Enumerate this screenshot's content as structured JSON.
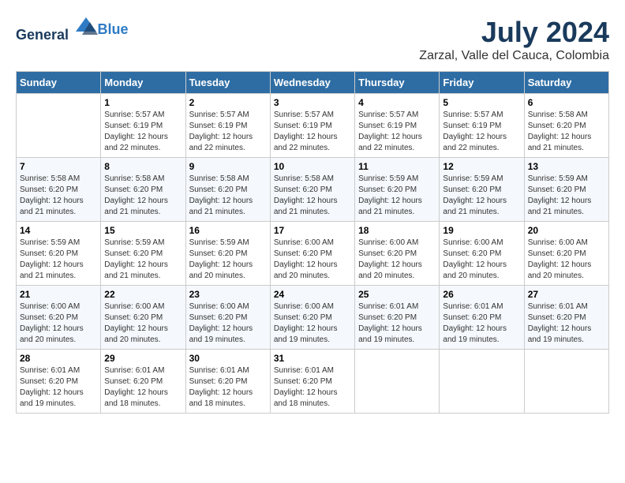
{
  "logo": {
    "general": "General",
    "blue": "Blue"
  },
  "title": "July 2024",
  "subtitle": "Zarzal, Valle del Cauca, Colombia",
  "days_of_week": [
    "Sunday",
    "Monday",
    "Tuesday",
    "Wednesday",
    "Thursday",
    "Friday",
    "Saturday"
  ],
  "weeks": [
    [
      {
        "day": "",
        "info": ""
      },
      {
        "day": "1",
        "info": "Sunrise: 5:57 AM\nSunset: 6:19 PM\nDaylight: 12 hours\nand 22 minutes."
      },
      {
        "day": "2",
        "info": "Sunrise: 5:57 AM\nSunset: 6:19 PM\nDaylight: 12 hours\nand 22 minutes."
      },
      {
        "day": "3",
        "info": "Sunrise: 5:57 AM\nSunset: 6:19 PM\nDaylight: 12 hours\nand 22 minutes."
      },
      {
        "day": "4",
        "info": "Sunrise: 5:57 AM\nSunset: 6:19 PM\nDaylight: 12 hours\nand 22 minutes."
      },
      {
        "day": "5",
        "info": "Sunrise: 5:57 AM\nSunset: 6:19 PM\nDaylight: 12 hours\nand 22 minutes."
      },
      {
        "day": "6",
        "info": "Sunrise: 5:58 AM\nSunset: 6:20 PM\nDaylight: 12 hours\nand 21 minutes."
      }
    ],
    [
      {
        "day": "7",
        "info": "Sunrise: 5:58 AM\nSunset: 6:20 PM\nDaylight: 12 hours\nand 21 minutes."
      },
      {
        "day": "8",
        "info": "Sunrise: 5:58 AM\nSunset: 6:20 PM\nDaylight: 12 hours\nand 21 minutes."
      },
      {
        "day": "9",
        "info": "Sunrise: 5:58 AM\nSunset: 6:20 PM\nDaylight: 12 hours\nand 21 minutes."
      },
      {
        "day": "10",
        "info": "Sunrise: 5:58 AM\nSunset: 6:20 PM\nDaylight: 12 hours\nand 21 minutes."
      },
      {
        "day": "11",
        "info": "Sunrise: 5:59 AM\nSunset: 6:20 PM\nDaylight: 12 hours\nand 21 minutes."
      },
      {
        "day": "12",
        "info": "Sunrise: 5:59 AM\nSunset: 6:20 PM\nDaylight: 12 hours\nand 21 minutes."
      },
      {
        "day": "13",
        "info": "Sunrise: 5:59 AM\nSunset: 6:20 PM\nDaylight: 12 hours\nand 21 minutes."
      }
    ],
    [
      {
        "day": "14",
        "info": "Sunrise: 5:59 AM\nSunset: 6:20 PM\nDaylight: 12 hours\nand 21 minutes."
      },
      {
        "day": "15",
        "info": "Sunrise: 5:59 AM\nSunset: 6:20 PM\nDaylight: 12 hours\nand 21 minutes."
      },
      {
        "day": "16",
        "info": "Sunrise: 5:59 AM\nSunset: 6:20 PM\nDaylight: 12 hours\nand 20 minutes."
      },
      {
        "day": "17",
        "info": "Sunrise: 6:00 AM\nSunset: 6:20 PM\nDaylight: 12 hours\nand 20 minutes."
      },
      {
        "day": "18",
        "info": "Sunrise: 6:00 AM\nSunset: 6:20 PM\nDaylight: 12 hours\nand 20 minutes."
      },
      {
        "day": "19",
        "info": "Sunrise: 6:00 AM\nSunset: 6:20 PM\nDaylight: 12 hours\nand 20 minutes."
      },
      {
        "day": "20",
        "info": "Sunrise: 6:00 AM\nSunset: 6:20 PM\nDaylight: 12 hours\nand 20 minutes."
      }
    ],
    [
      {
        "day": "21",
        "info": "Sunrise: 6:00 AM\nSunset: 6:20 PM\nDaylight: 12 hours\nand 20 minutes."
      },
      {
        "day": "22",
        "info": "Sunrise: 6:00 AM\nSunset: 6:20 PM\nDaylight: 12 hours\nand 20 minutes."
      },
      {
        "day": "23",
        "info": "Sunrise: 6:00 AM\nSunset: 6:20 PM\nDaylight: 12 hours\nand 19 minutes."
      },
      {
        "day": "24",
        "info": "Sunrise: 6:00 AM\nSunset: 6:20 PM\nDaylight: 12 hours\nand 19 minutes."
      },
      {
        "day": "25",
        "info": "Sunrise: 6:01 AM\nSunset: 6:20 PM\nDaylight: 12 hours\nand 19 minutes."
      },
      {
        "day": "26",
        "info": "Sunrise: 6:01 AM\nSunset: 6:20 PM\nDaylight: 12 hours\nand 19 minutes."
      },
      {
        "day": "27",
        "info": "Sunrise: 6:01 AM\nSunset: 6:20 PM\nDaylight: 12 hours\nand 19 minutes."
      }
    ],
    [
      {
        "day": "28",
        "info": "Sunrise: 6:01 AM\nSunset: 6:20 PM\nDaylight: 12 hours\nand 19 minutes."
      },
      {
        "day": "29",
        "info": "Sunrise: 6:01 AM\nSunset: 6:20 PM\nDaylight: 12 hours\nand 18 minutes."
      },
      {
        "day": "30",
        "info": "Sunrise: 6:01 AM\nSunset: 6:20 PM\nDaylight: 12 hours\nand 18 minutes."
      },
      {
        "day": "31",
        "info": "Sunrise: 6:01 AM\nSunset: 6:20 PM\nDaylight: 12 hours\nand 18 minutes."
      },
      {
        "day": "",
        "info": ""
      },
      {
        "day": "",
        "info": ""
      },
      {
        "day": "",
        "info": ""
      }
    ]
  ]
}
